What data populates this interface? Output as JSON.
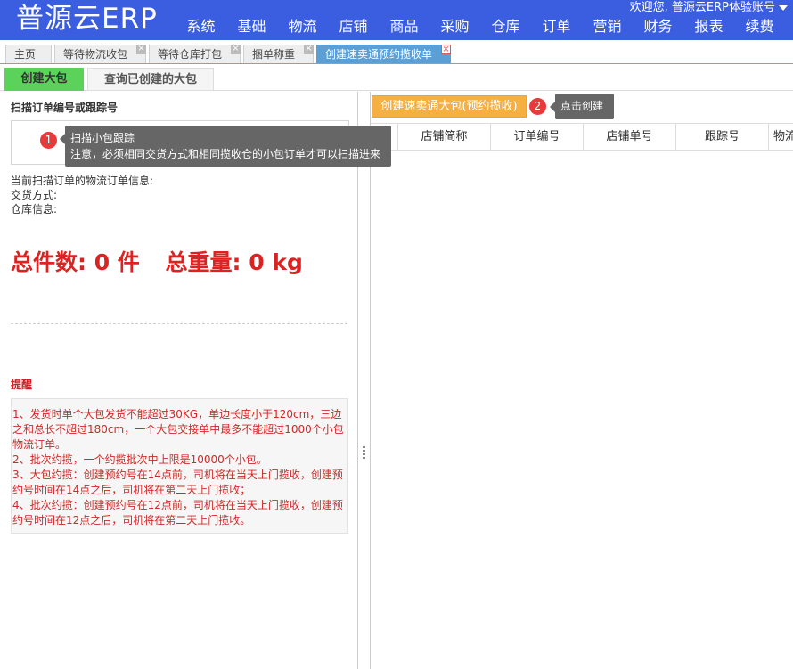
{
  "app": {
    "logo": "普源云ERP",
    "welcome": "欢迎您, 普源云ERP体验账号"
  },
  "nav": [
    "系统",
    "基础",
    "物流",
    "店铺",
    "商品",
    "采购",
    "仓库",
    "订单",
    "营销",
    "财务",
    "报表",
    "续费"
  ],
  "tabs": [
    "主页",
    "等待物流收包",
    "等待仓库打包",
    "捆单称重",
    "创建速卖通预约揽收单"
  ],
  "tab_close_glyph": "×",
  "subtabs": {
    "create": "创建大包",
    "query": "查询已创建的大包"
  },
  "left": {
    "scan_title": "扫描订单编号或跟踪号",
    "info": {
      "order_info": "当前扫描订单的物流订单信息:",
      "delivery": "交货方式:",
      "warehouse": "仓库信息:"
    },
    "total_count": "总件数: 0 件",
    "total_weight": "总重量: 0 kg",
    "remind_title": "提醒",
    "remind_lines": [
      "1、发货时单个大包发货不能超过30KG，单边长度小于120cm，三边之和总长不超过180cm，一个大包交接单中最多不能超过1000个小包物流订单。",
      "2、批次约揽，一个约揽批次中上限是10000个小包。",
      "3、大包约揽：创建预约号在14点前，司机将在当天上门揽收，创建预约号时间在14点之后，司机将在第二天上门揽收；",
      "4、批次约揽：创建预约号在12点前，司机将在当天上门揽收，创建预约号时间在12点之后，司机将在第二天上门揽收。"
    ]
  },
  "right": {
    "create_button": "创建速卖通大包(预约揽收)",
    "columns": [
      "店铺简称",
      "订单编号",
      "店铺单号",
      "跟踪号",
      "物流"
    ]
  },
  "callouts": {
    "one": {
      "number": "1",
      "line1": "扫描小包跟踪",
      "line2": "注意，必须相同交货方式和相同揽收仓的小包订单才可以扫描进来"
    },
    "two": {
      "number": "2",
      "text": "点击创建"
    }
  }
}
